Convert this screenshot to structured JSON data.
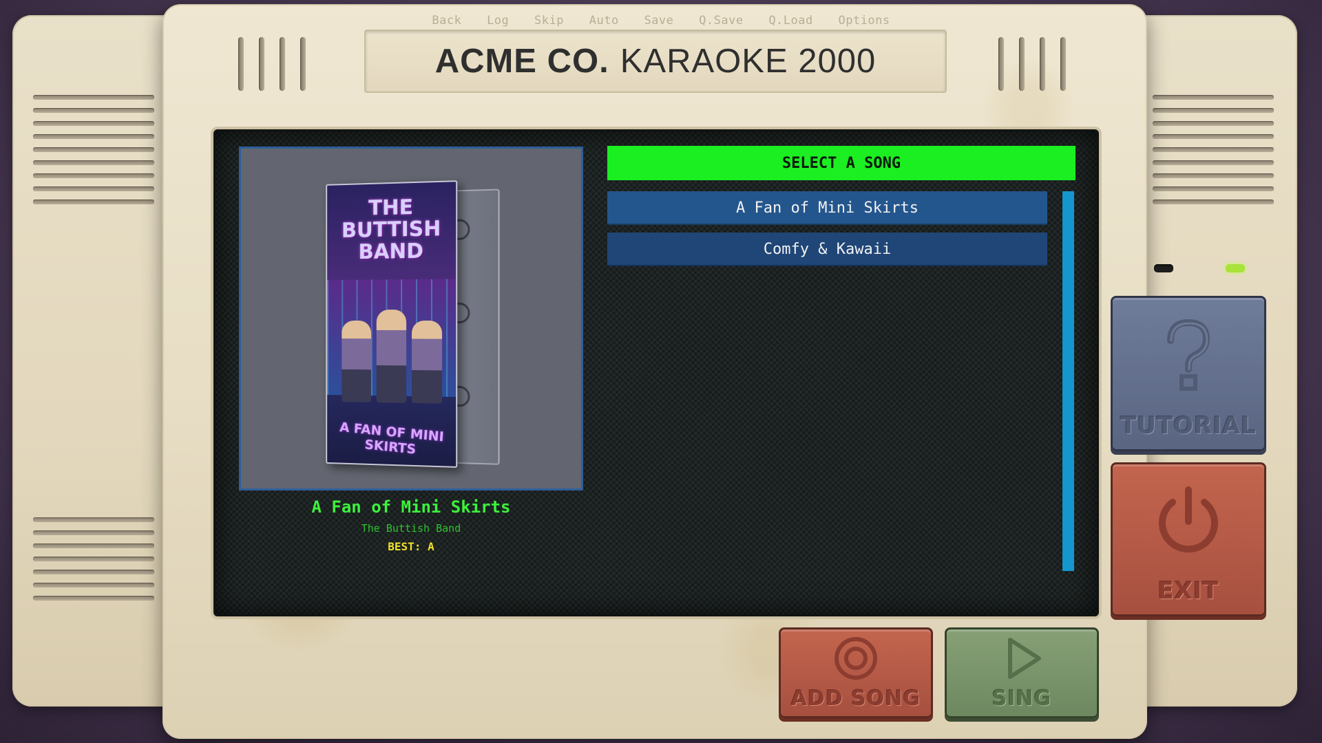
{
  "quick_menu": [
    "Back",
    "Log",
    "Skip",
    "Auto",
    "Save",
    "Q.Save",
    "Q.Load",
    "Options"
  ],
  "console": {
    "brand": "ACME CO.",
    "model": "KARAOKE 2000"
  },
  "album_art": {
    "cover_title_lines": [
      "THE",
      "BUTTISH",
      "BAND"
    ],
    "cover_subtitle": "A FAN OF MINI SKIRTS"
  },
  "selected_song": {
    "title": "A Fan of Mini Skirts",
    "artist": "The Buttish Band",
    "best": "BEST: A"
  },
  "song_list": {
    "header": "SELECT A SONG",
    "items": [
      {
        "label": "A Fan of Mini Skirts"
      },
      {
        "label": "Comfy & Kawaii"
      }
    ]
  },
  "buttons": {
    "tutorial": "TUTORIAL",
    "exit": "EXIT",
    "add_song": "ADD SONG",
    "sing": "SING"
  },
  "leds": {
    "left": "off",
    "right": "on"
  },
  "colors": {
    "header_green": "#1bef22",
    "title_green": "#3cf23c",
    "best_yellow": "#f0e02a",
    "list_blue": "#24568e",
    "scrollbar": "#1496cf"
  }
}
